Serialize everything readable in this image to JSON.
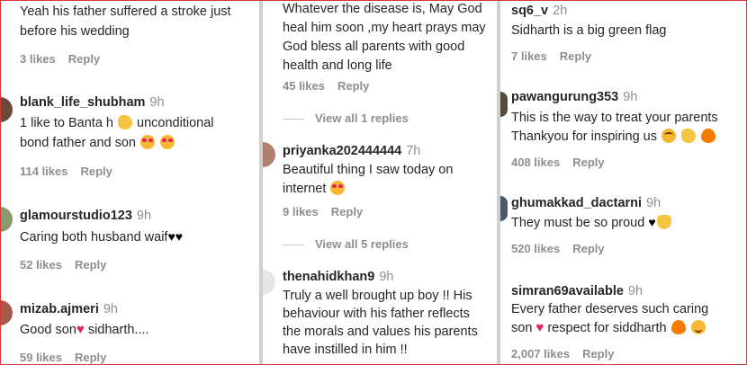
{
  "reply_label": "Reply",
  "col1": [
    {
      "text1": "Yeah his father suffered a stroke just",
      "text2": "before his wedding",
      "likes": "3 likes"
    },
    {
      "user": "blank_life_shubham",
      "time": "9h",
      "text1a": "1 like to Banta h ",
      "text1b": " unconditional",
      "text2": "bond father and son ",
      "likes": "114 likes"
    },
    {
      "user": "glamourstudio123",
      "time": "9h",
      "text1": "Caring both husband waif",
      "likes": "52 likes"
    },
    {
      "user": "mizab.ajmeri",
      "time": "9h",
      "text1a": "Good son",
      "text1b": " sidharth....",
      "likes": "59 likes"
    }
  ],
  "col2": [
    {
      "text1": "Whatever the disease is, May God",
      "text2": "heal him soon ,my heart prays may",
      "text3": "God bless all parents with good",
      "text4": "health and long life",
      "likes": "45 likes"
    },
    {
      "viewall": "View all 1 replies"
    },
    {
      "user": "priyanka202444444",
      "time": "7h",
      "text1": "Beautiful thing I saw today on",
      "text2": "internet ",
      "likes": "9 likes"
    },
    {
      "viewall": "View all 5 replies"
    },
    {
      "user": "thenahidkhan9",
      "time": "9h",
      "text1": "Truly a well brought up boy !! His",
      "text2": "behaviour with his father reflects",
      "text3": "the morals and values his parents",
      "text4": "have instilled in him !!"
    }
  ],
  "col3": [
    {
      "user": "sq6_v",
      "time": "2h",
      "text1": "Sidharth is a big green flag",
      "likes": "7 likes"
    },
    {
      "user": "pawangurung353",
      "time": "9h",
      "text1": "This is the way to treat your parents",
      "text2": "Thankyou for inspiring us ",
      "likes": "408 likes"
    },
    {
      "user": "ghumakkad_dactarni",
      "time": "9h",
      "text1": "They must be so proud ",
      "likes": "520 likes"
    },
    {
      "user": "simran69available",
      "time": "9h",
      "text1": "Every father deserves such caring",
      "text2a": "son",
      "text2b": " respect for siddharth ",
      "likes": "2,007 likes"
    }
  ],
  "colors": {
    "username": "#262626",
    "meta": "#8e8e8e",
    "heart": "#e0245e",
    "border": "#d23a3a"
  },
  "icons": {
    "face": "smiling-face-with-heart-eyes-icon",
    "clap": "clapping-hands-icon",
    "fire": "fire-icon",
    "heart": "red-heart-icon",
    "black_heart": "black-heart-icon",
    "flush": "flushed-face-icon",
    "smile": "smiling-face-icon",
    "raised_hands": "raising-hands-icon"
  }
}
